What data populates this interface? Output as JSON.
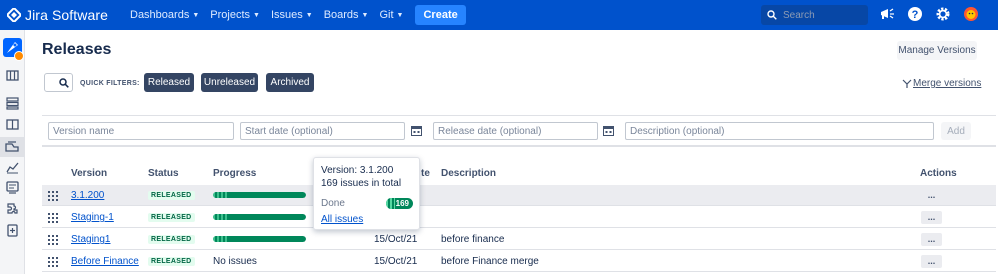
{
  "nav": {
    "product": "Jira Software",
    "items": [
      {
        "label": "Dashboards"
      },
      {
        "label": "Projects"
      },
      {
        "label": "Issues"
      },
      {
        "label": "Boards"
      },
      {
        "label": "Git"
      }
    ],
    "create_label": "Create",
    "search_placeholder": "Search",
    "icons": [
      "megaphone-icon",
      "help-icon",
      "settings-icon",
      "avatar"
    ]
  },
  "sidebar": {
    "icons": [
      "project-avatar",
      "backlog-icon",
      "board-icon",
      "columns-icon",
      "releases-icon",
      "reports-icon",
      "issues-icon",
      "components-icon",
      "add-item-icon"
    ]
  },
  "page": {
    "title": "Releases",
    "manage_label": "Manage Versions",
    "quick_filters_label": "QUICK FILTERS:",
    "filters": [
      "Released",
      "Unreleased",
      "Archived"
    ],
    "merge_label": "Merge versions"
  },
  "add_form": {
    "version_placeholder": "Version name",
    "start_placeholder": "Start date (optional)",
    "release_placeholder": "Release date (optional)",
    "description_placeholder": "Description (optional)",
    "add_label": "Add"
  },
  "table": {
    "headers": {
      "version": "Version",
      "status": "Status",
      "progress": "Progress",
      "release_date": "te",
      "description": "Description",
      "actions": "Actions"
    },
    "rows": [
      {
        "version": "3.1.200",
        "status": "RELEASED",
        "progress": 1.0,
        "release_date": "",
        "description": "",
        "actions": "..."
      },
      {
        "version": "Staging-1",
        "status": "RELEASED",
        "progress": 1.0,
        "release_date": "",
        "description": "",
        "actions": "..."
      },
      {
        "version": "Staging1",
        "status": "RELEASED",
        "progress": 1.0,
        "release_date": "15/Oct/21",
        "description": "before finance",
        "actions": "..."
      },
      {
        "version": "Before Finance",
        "status": "RELEASED",
        "progress_text": "No issues",
        "release_date": "15/Oct/21",
        "description": "before Finance merge",
        "actions": "..."
      }
    ]
  },
  "tooltip": {
    "version_line": "Version: 3.1.200",
    "count_line": "169 issues in total",
    "done_label": "Done",
    "done_count": "169",
    "all_issues_link": "All issues"
  },
  "colors": {
    "nav": "#0052cc",
    "create": "#2684ff",
    "success": "#00875a",
    "link": "#0052cc",
    "filter_btn": "#344563"
  }
}
